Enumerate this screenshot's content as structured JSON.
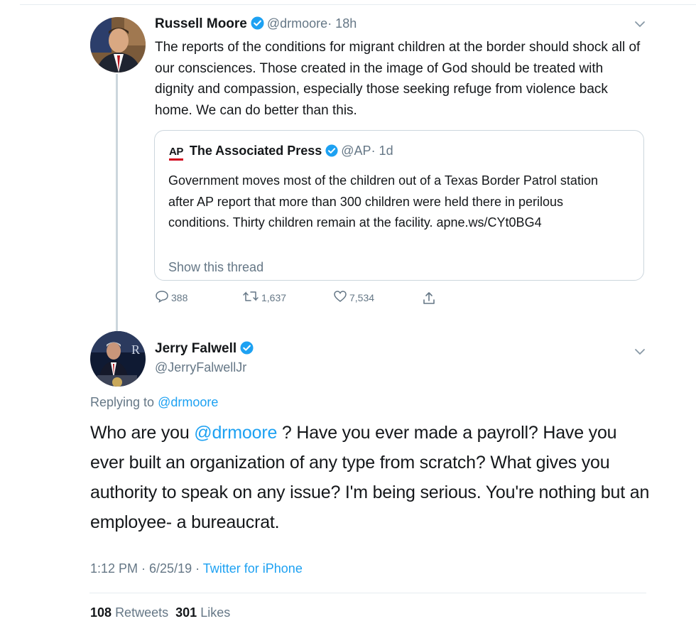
{
  "tweet1": {
    "author_name": "Russell Moore",
    "author_handle": "@drmoore",
    "time": "· 18h",
    "text": "The reports of the conditions for migrant children at the border should shock all of our consciences. Those created in the image of God should be treated with dignity and compassion, especially those seeking refuge from violence back home. We can do better than this.",
    "quote": {
      "logo": "AP",
      "author_name": "The Associated Press",
      "author_handle": "@AP",
      "time": "· 1d",
      "text": "Government moves most of the children out of a Texas Border Patrol station after AP report that more than 300 children were held there in perilous conditions. Thirty children remain at the facility. apne.ws/CYt0BG4",
      "show_thread": "Show this thread"
    },
    "actions": {
      "replies": "388",
      "retweets": "1,637",
      "likes": "7,534"
    }
  },
  "tweet2": {
    "author_name": "Jerry Falwell",
    "author_handle": "@JerryFalwellJr",
    "replying_prefix": "Replying to",
    "replying_handle": "@drmoore",
    "text_before": "Who are you ",
    "text_mention": "@drmoore",
    "text_after": " ?  Have you ever made a payroll? Have you ever built an organization of any type from scratch? What gives you authority to speak on any issue?  I'm being serious.  You're nothing but an employee- a bureaucrat.",
    "time": "1:12 PM · 6/25/19 · ",
    "source": "Twitter for iPhone",
    "retweets_count": "108",
    "retweets_label": "Retweets",
    "likes_count": "301",
    "likes_label": "Likes"
  },
  "colors": {
    "accent": "#1da1f2",
    "secondary_text": "#657786",
    "primary_text": "#14171a",
    "border": "#ccd6dd",
    "ap_red": "#d0021b"
  },
  "icons": [
    "verified-badge-icon",
    "chevron-down-icon",
    "reply-icon",
    "retweet-icon",
    "like-icon",
    "share-icon"
  ]
}
